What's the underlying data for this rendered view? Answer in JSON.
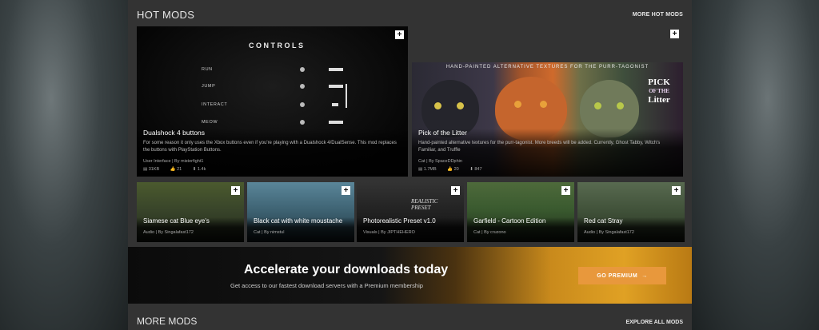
{
  "hot_mods": {
    "title": "HOT MODS",
    "more_link": "MORE HOT MODS"
  },
  "controls_preview": {
    "heading": "CONTROLS",
    "rows": [
      "RUN",
      "JUMP",
      "INTERACT",
      "MEOW"
    ]
  },
  "litter_preview": {
    "banner": "HAND-PAINTED ALTERNATIVE TEXTURES FOR THE PURR-TAGONIST",
    "logo_line1": "PICK",
    "logo_line2": "OF THE",
    "logo_line3": "Litter"
  },
  "featured": [
    {
      "title": "Dualshock 4 buttons",
      "description": "For some reason it only uses the Xbox buttons even if you're playing with a Dualshock 4/DualSense. This mod replaces the buttons with PlayStation Buttons.",
      "category": "User Interface",
      "author": "By misterfight1",
      "size": "31KB",
      "endorsements": "21",
      "downloads": "1.4k"
    },
    {
      "title": "Pick of the Litter",
      "description": "Hand-painted alternative textures for the purr-tagonist. More breeds will be added. Currently, Ghost Tabby, Witch's Familiar, and Truffle",
      "category": "Cat",
      "author": "By SpaceDDphin",
      "size": "1.7MB",
      "endorsements": "20",
      "downloads": "847"
    }
  ],
  "small_mods": [
    {
      "title": "Siamese cat Blue eye's",
      "category": "Audio",
      "author": "By Singalafast172"
    },
    {
      "title": "Black cat with white moustache",
      "category": "Cat",
      "author": "By nimstul"
    },
    {
      "title": "Photorealistic Preset v1.0",
      "category": "Visuals",
      "author": "By JIPTHEHERO",
      "overlay_text": "REALISTIC PRESET"
    },
    {
      "title": "Garfield - Cartoon Edition",
      "category": "Cat",
      "author": "By cruzono"
    },
    {
      "title": "Red cat Stray",
      "category": "Audio",
      "author": "By Singalafast172"
    }
  ],
  "premium": {
    "title": "Accelerate your downloads today",
    "subtitle": "Get access to our fastest download servers with a Premium membership",
    "button": "GO PREMIUM"
  },
  "more_mods": {
    "title": "MORE MODS",
    "link": "EXPLORE ALL MODS"
  },
  "icons": {
    "add": "+",
    "arrow": "→"
  },
  "colors": {
    "panel": "#333333",
    "premium_button": "#e8983c"
  }
}
